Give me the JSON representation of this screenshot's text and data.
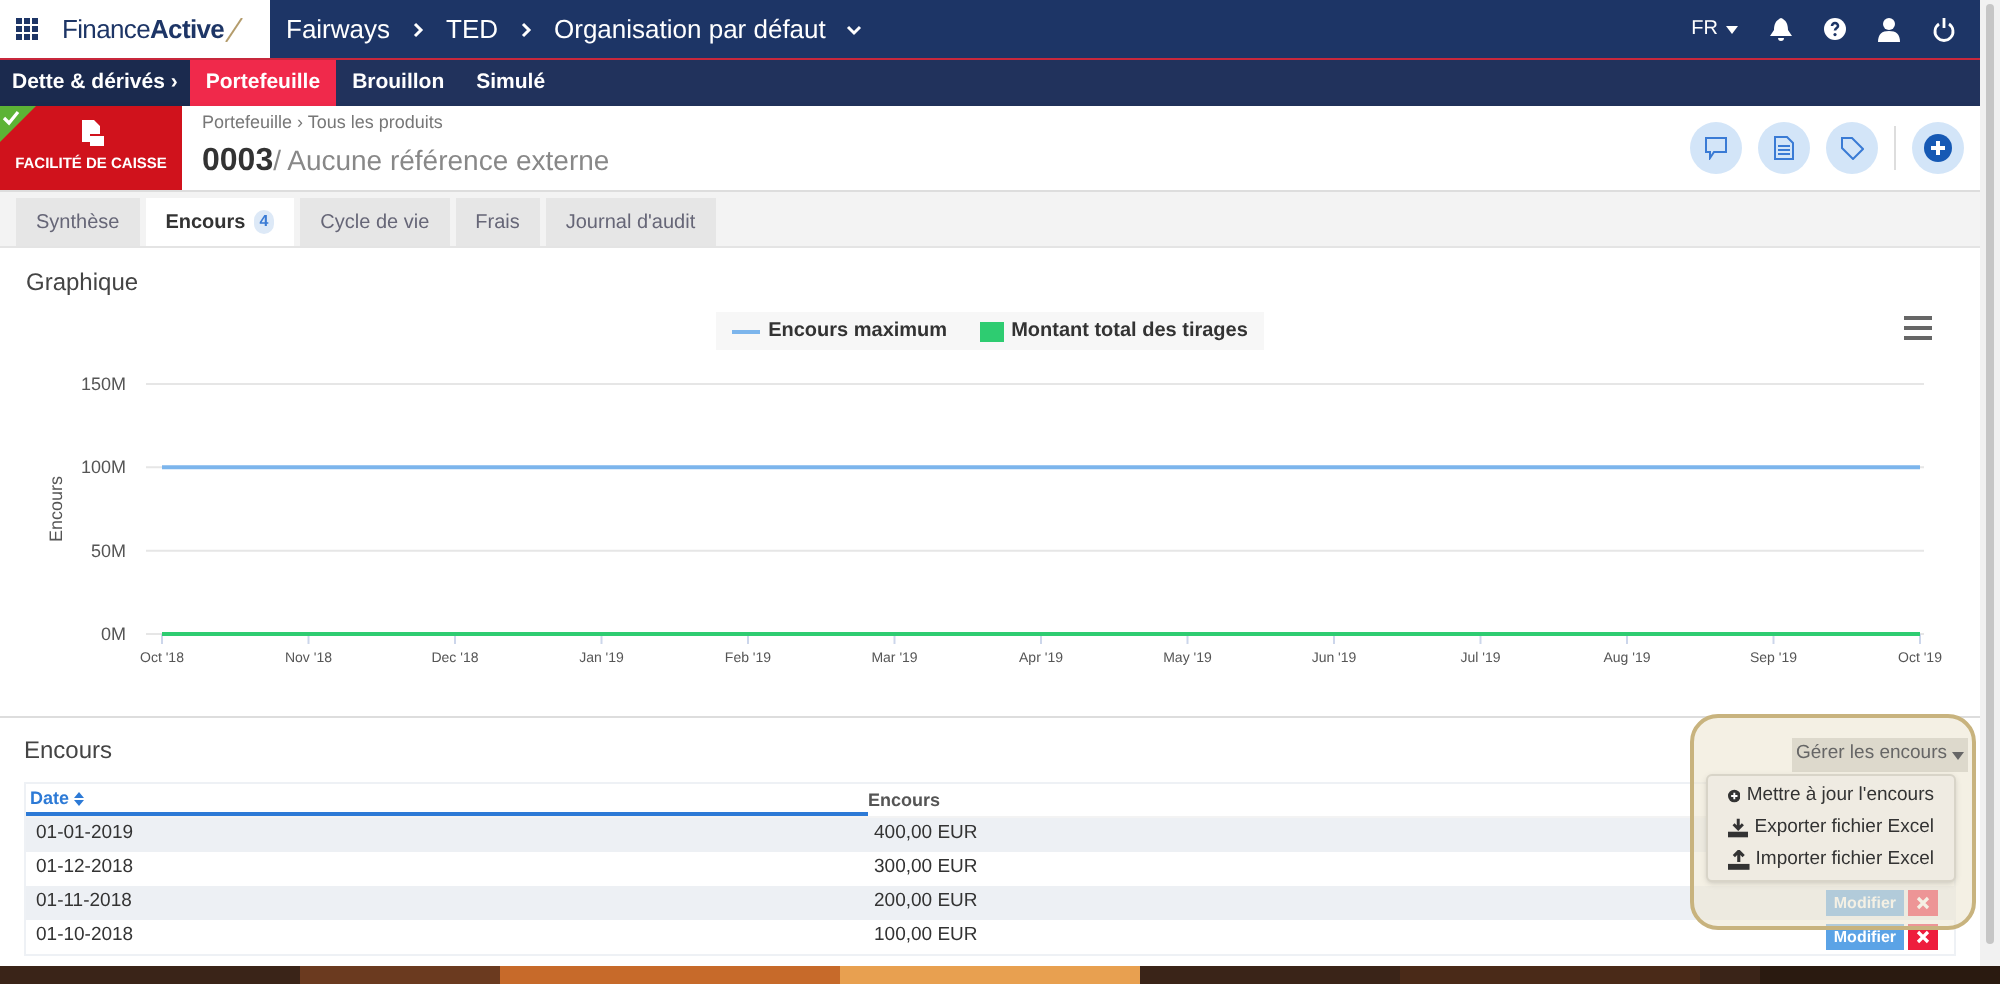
{
  "topbar": {
    "logo": {
      "part1": "Finance",
      "part2": "Active"
    },
    "breadcrumb": [
      "Fairways",
      "TED",
      "Organisation par défaut"
    ],
    "language": "FR"
  },
  "subnav": {
    "section": "Dette & dérivés ›",
    "items": [
      {
        "label": "Portefeuille",
        "selected": true
      },
      {
        "label": "Brouillon",
        "selected": false
      },
      {
        "label": "Simulé",
        "selected": false
      }
    ]
  },
  "product": {
    "type": "FACILITÉ DE CAISSE",
    "validated": true,
    "breadcrumb": "Portefeuille › Tous les produits",
    "number": "0003",
    "reference": "/ Aucune référence externe"
  },
  "tabs": [
    {
      "label": "Synthèse",
      "selected": false
    },
    {
      "label": "Encours",
      "selected": true,
      "count": "4"
    },
    {
      "label": "Cycle de vie",
      "selected": false
    },
    {
      "label": "Frais",
      "selected": false
    },
    {
      "label": "Journal d'audit",
      "selected": false
    }
  ],
  "graph": {
    "title": "Graphique",
    "chart_data": {
      "type": "line",
      "legend": true,
      "ylabel": "Encours",
      "categories": [
        "Oct '18",
        "Nov '18",
        "Dec '18",
        "Jan '19",
        "Feb '19",
        "Mar '19",
        "Apr '19",
        "May '19",
        "Jun '19",
        "Jul '19",
        "Aug '19",
        "Sep '19",
        "Oct '19"
      ],
      "series": [
        {
          "name": "Encours maximum",
          "color": "#7cb5ec",
          "values": [
            100,
            100,
            100,
            100,
            100,
            100,
            100,
            100,
            100,
            100,
            100,
            100,
            100
          ]
        },
        {
          "name": "Montant total des tirages",
          "color": "#2ecc71",
          "values": [
            0,
            0,
            0,
            0,
            0,
            0,
            0,
            0,
            0,
            0,
            0,
            0,
            0
          ]
        }
      ],
      "ylim": [
        0,
        150
      ],
      "yticks": [
        {
          "value": 0,
          "label": "0M"
        },
        {
          "value": 50,
          "label": "50M"
        },
        {
          "value": 100,
          "label": "100M"
        },
        {
          "value": 150,
          "label": "150M"
        }
      ]
    }
  },
  "encours": {
    "title": "Encours",
    "manage": {
      "label": "Gérer les encours",
      "expanded": true,
      "items": [
        "Mettre à jour l'encours",
        "Exporter fichier Excel",
        "Importer fichier Excel"
      ]
    },
    "columns": [
      "Date",
      "Encours"
    ],
    "rows": [
      {
        "date": "01-01-2019",
        "amount": "400,00 EUR"
      },
      {
        "date": "01-12-2018",
        "amount": "300,00 EUR"
      },
      {
        "date": "01-11-2018",
        "amount": "200,00 EUR",
        "action": "Modifier",
        "deletable": true
      },
      {
        "date": "01-10-2018",
        "amount": "100,00 EUR",
        "action": "Modifier",
        "deletable": true
      }
    ]
  }
}
